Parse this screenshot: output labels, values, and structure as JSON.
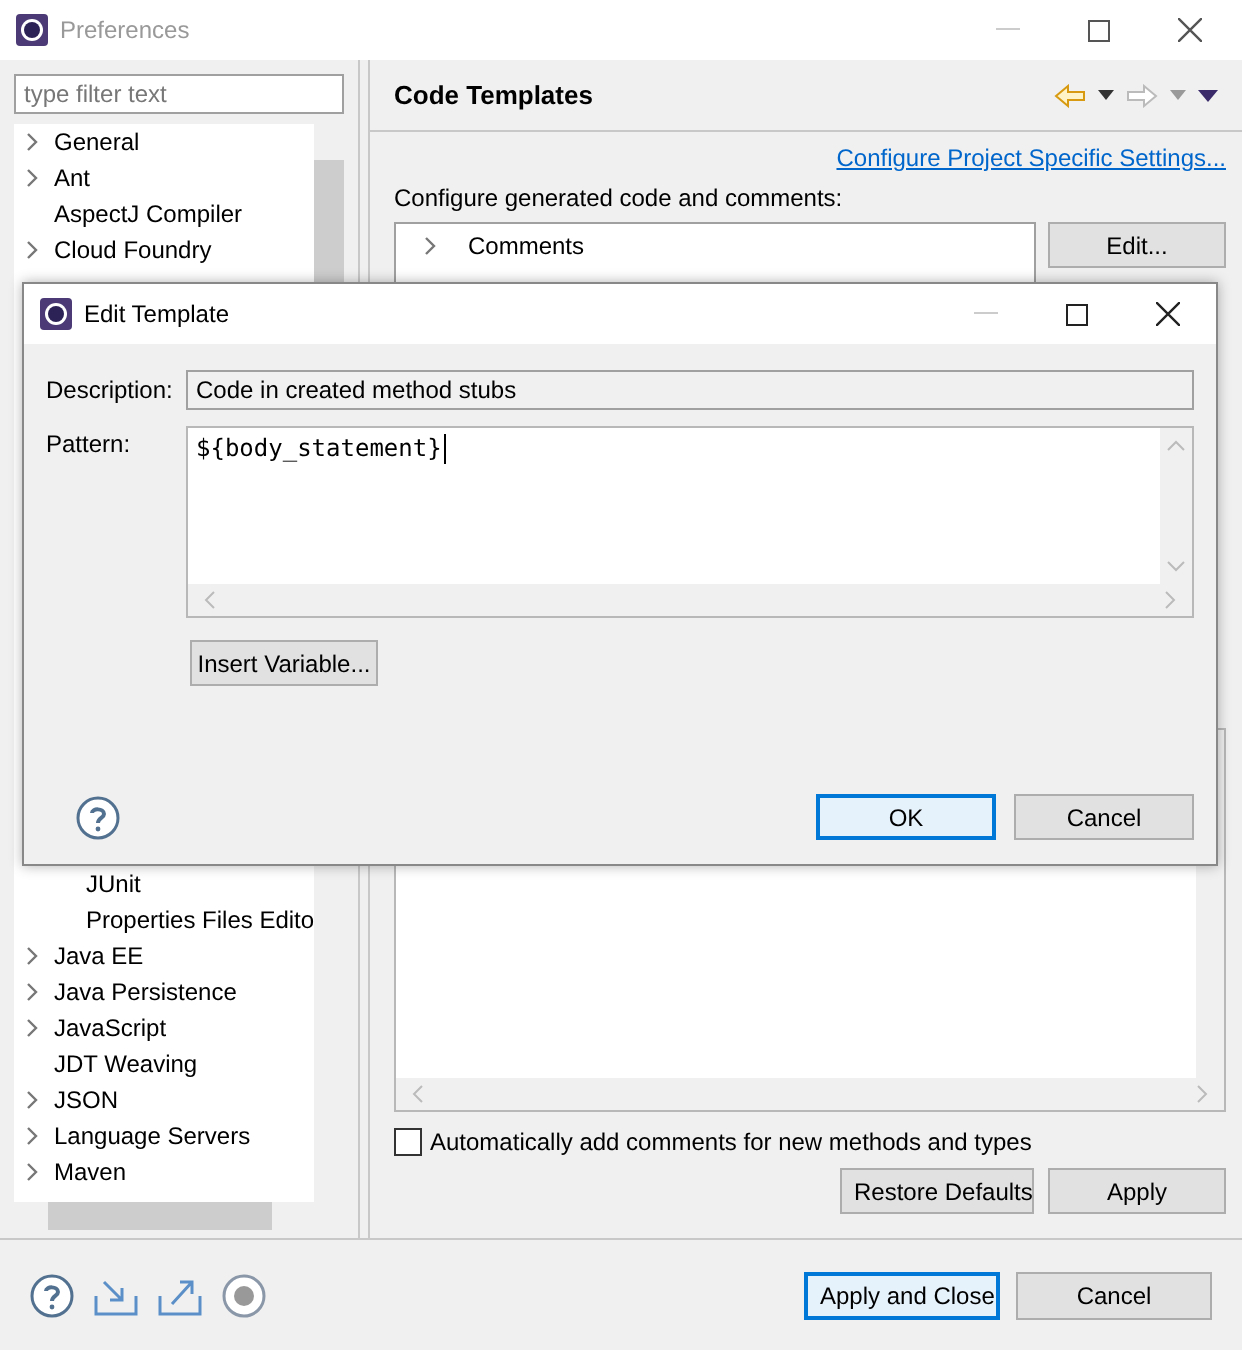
{
  "window": {
    "title": "Preferences"
  },
  "filter": {
    "placeholder": "type filter text"
  },
  "tree_upper": [
    {
      "label": "General",
      "expandable": true
    },
    {
      "label": "Ant",
      "expandable": true
    },
    {
      "label": "AspectJ Compiler",
      "expandable": false
    },
    {
      "label": "Cloud Foundry",
      "expandable": true
    }
  ],
  "tree_lower": [
    {
      "children": [
        {
          "label": "JUnit",
          "expandable": false
        },
        {
          "label": "Properties Files Edito",
          "expandable": false
        }
      ]
    },
    {
      "label": "Java EE",
      "expandable": true
    },
    {
      "label": "Java Persistence",
      "expandable": true
    },
    {
      "label": "JavaScript",
      "expandable": true
    },
    {
      "label": "JDT Weaving",
      "expandable": false
    },
    {
      "label": "JSON",
      "expandable": true
    },
    {
      "label": "Language Servers",
      "expandable": true
    },
    {
      "label": "Maven",
      "expandable": true
    }
  ],
  "page": {
    "title": "Code Templates",
    "link": "Configure Project Specific Settings...",
    "label": "Configure generated code and comments:",
    "templates": [
      {
        "label": "Comments",
        "expanded": false
      }
    ],
    "edit_button": "Edit...",
    "auto_comments": {
      "label": "Automatically add comments for new methods and types",
      "checked": false
    },
    "buttons": [
      "Restore Defaults",
      "Apply"
    ]
  },
  "footer_buttons": [
    {
      "label": "Apply and Close",
      "default": true
    },
    {
      "label": "Cancel",
      "default": false
    }
  ],
  "dialog": {
    "title": "Edit Template",
    "description_label": "Description:",
    "description": "Code in created method stubs",
    "pattern_label": "Pattern:",
    "pattern": "${body_statement}",
    "insert_button": "Insert Variable...",
    "buttons": [
      {
        "label": "OK",
        "default": true
      },
      {
        "label": "Cancel",
        "default": false
      }
    ]
  }
}
